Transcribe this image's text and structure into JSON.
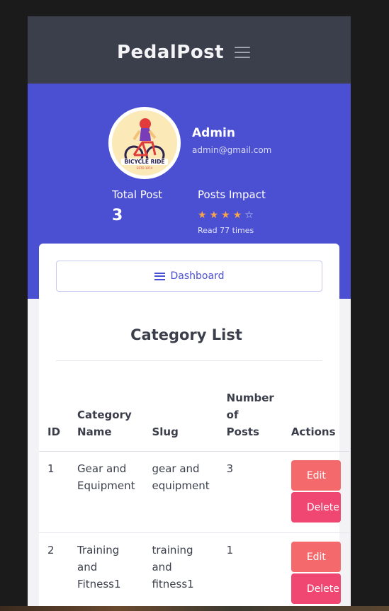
{
  "navbar": {
    "brand": "PedalPost",
    "menu_icon": "hamburger-menu-icon"
  },
  "profile": {
    "avatar_badge_text": "BICYCLE RIDE",
    "avatar_badge_sub": "ESTD 1974",
    "name": "Admin",
    "email": "admin@gmail.com"
  },
  "stats": {
    "total_label": "Total Post",
    "total_value": "3",
    "impact_label": "Posts Impact",
    "rating": 4,
    "rating_max": 5,
    "read_text": "Read 77 times"
  },
  "colors": {
    "hero": "#4b4fd1",
    "navbar": "#3b3f4b",
    "edit": "#f4696b",
    "delete": "#ef4772",
    "star": "#f7a54a"
  },
  "dashboard_button": {
    "label": "Dashboard",
    "icon": "list-icon"
  },
  "category_list": {
    "title": "Category List",
    "headers": {
      "id": "ID",
      "name": "Category Name",
      "slug": "Slug",
      "count": "Number of Posts",
      "actions": "Actions"
    },
    "rows": [
      {
        "id": "1",
        "name": "Gear and Equipment",
        "slug": "gear and equipment",
        "count": "3",
        "edit": "Edit",
        "delete": "Delete"
      },
      {
        "id": "2",
        "name": "Training and Fitness1",
        "slug": "training and fitness1",
        "count": "1",
        "edit": "Edit",
        "delete": "Delete"
      }
    ]
  }
}
